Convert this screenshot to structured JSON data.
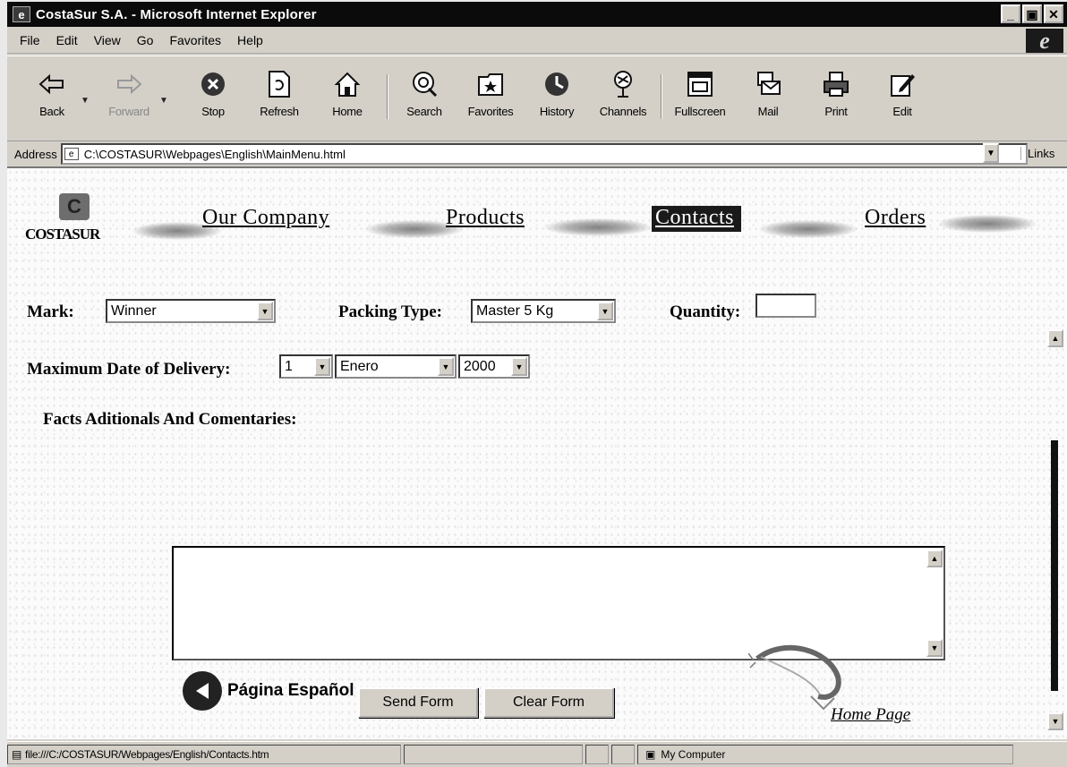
{
  "window": {
    "title": "CostaSur S.A. - Microsoft Internet Explorer"
  },
  "menu": [
    "File",
    "Edit",
    "View",
    "Go",
    "Favorites",
    "Help"
  ],
  "toolbar": {
    "back": "Back",
    "forward": "Forward",
    "stop": "Stop",
    "refresh": "Refresh",
    "home": "Home",
    "search": "Search",
    "favorites": "Favorites",
    "history": "History",
    "channels": "Channels",
    "fullscreen": "Fullscreen",
    "mail": "Mail",
    "print": "Print",
    "edit": "Edit"
  },
  "address": {
    "label": "Address",
    "value": "C:\\COSTASUR\\Webpages\\English\\MainMenu.html",
    "links": "Links"
  },
  "nav": {
    "logo_text": "COSTASUR",
    "our_company": "Our Company",
    "products": "Products",
    "contacts": "Contacts",
    "orders": "Orders"
  },
  "form": {
    "mark_label": "Mark:",
    "mark_value": "Winner",
    "packing_label": "Packing Type:",
    "packing_value": "Master 5 Kg",
    "quantity_label": "Quantity:",
    "delivery_label": "Maximum Date of Delivery:",
    "day_value": "1",
    "month_value": "Enero",
    "year_value": "2000",
    "comments_label": "Facts Aditionals And Comentaries:",
    "send_label": "Send Form",
    "clear_label": "Clear Form"
  },
  "footer": {
    "spanish_page": "Página Español",
    "home_page": "Home Page"
  },
  "status": {
    "url": "file:///C:/COSTASUR/Webpages/English/Contacts.htm",
    "zone": "My Computer"
  },
  "icons": [
    "ie-page-icon",
    "back-icon",
    "forward-icon",
    "stop-icon",
    "refresh-icon",
    "home-icon",
    "search-icon",
    "favorites-icon",
    "history-icon",
    "channels-icon",
    "fullscreen-icon",
    "mail-icon",
    "print-icon",
    "edit-icon",
    "ie-logo-icon",
    "shrimp-icon",
    "back-arrow-icon",
    "computer-icon"
  ]
}
